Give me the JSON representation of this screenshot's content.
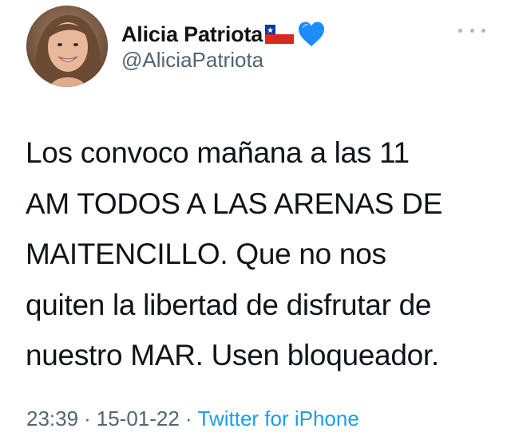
{
  "author": {
    "display_name": "Alicia Patriota",
    "handle": "@AliciaPatriota",
    "name_emojis": [
      "chile-flag-icon",
      "blue-heart-icon"
    ]
  },
  "tweet": {
    "text_lines": [
      "Los convoco mañana a las 11",
      "AM TODOS A LAS ARENAS DE",
      "MAITENCILLO. Que no nos",
      "quiten la libertad de disfrutar de",
      "nuestro MAR. Usen bloqueador."
    ],
    "time": "23:39",
    "date": "15-01-22",
    "separator": "·",
    "source": "Twitter for iPhone"
  },
  "colors": {
    "text": "#0f1419",
    "secondary": "#536471",
    "link": "#1d9bf0",
    "heart": "#1d8cf8",
    "flag_red": "#d52b1e",
    "flag_blue": "#0039a6"
  }
}
